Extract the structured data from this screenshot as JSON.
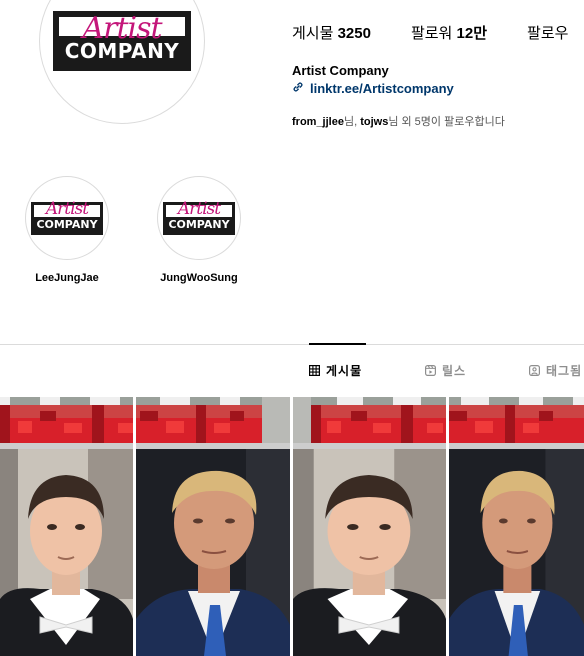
{
  "profile": {
    "logo_script": "Artist",
    "logo_bar": "COMPANY",
    "name": "Artist Company",
    "link": "linktr.ee/Artistcompany",
    "followed_by": {
      "user1": "from_jjlee",
      "sep1": "님, ",
      "user2": "tojws",
      "rest": "님 외 5명이 팔로우합니다"
    }
  },
  "stats": [
    {
      "label": "게시물",
      "value": "3250"
    },
    {
      "label": "팔로워",
      "value": "12만"
    },
    {
      "label": "팔로우",
      "value": ""
    }
  ],
  "highlights": [
    {
      "label": "LeeJungJae"
    },
    {
      "label": "JungWooSung"
    }
  ],
  "tabs": [
    {
      "label": "게시물",
      "icon": "grid-icon",
      "active": true
    },
    {
      "label": "릴스",
      "icon": "reels-icon",
      "active": false
    },
    {
      "label": "태그됨",
      "icon": "tagged-icon",
      "active": false
    }
  ],
  "colors": {
    "logo_magenta": "#c4167a",
    "link_blue": "#00376b",
    "censor_red": "#d8202a"
  }
}
